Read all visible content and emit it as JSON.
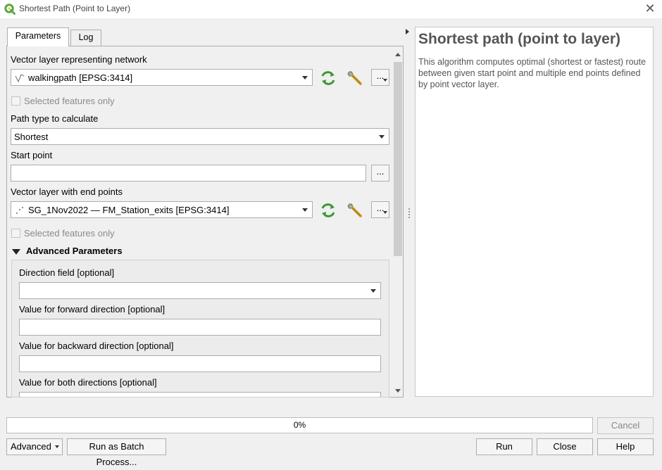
{
  "window": {
    "title": "Shortest Path (Point to Layer)",
    "accent_color": "#59a843"
  },
  "tabs": [
    {
      "label": "Parameters",
      "active": true
    },
    {
      "label": "Log",
      "active": false
    }
  ],
  "params": {
    "network_layer": {
      "label": "Vector layer representing network",
      "value": "walkingpath [EPSG:3414]",
      "selected_only_label": "Selected features only",
      "ellipsis": "..."
    },
    "path_type": {
      "label": "Path type to calculate",
      "value": "Shortest"
    },
    "start_point": {
      "label": "Start point",
      "value": "",
      "ellipsis": "..."
    },
    "end_points_layer": {
      "label": "Vector layer with end points",
      "value": "SG_1Nov2022 — FM_Station_exits [EPSG:3414]",
      "selected_only_label": "Selected features only",
      "ellipsis": "..."
    },
    "advanced": {
      "header": "Advanced Parameters",
      "direction_field_label": "Direction field [optional]",
      "direction_field_value": "",
      "forward_label": "Value for forward direction [optional]",
      "forward_value": "",
      "backward_label": "Value for backward direction [optional]",
      "backward_value": "",
      "both_label": "Value for both directions [optional]"
    }
  },
  "help": {
    "title": "Shortest path (point to layer)",
    "body": "This algorithm computes optimal (shortest or fastest) route between given start point and multiple end points defined by point vector layer."
  },
  "progress": {
    "value": 0,
    "text": "0%"
  },
  "buttons": {
    "cancel": "Cancel",
    "advanced": "Advanced",
    "batch": "Run as Batch Process...",
    "run": "Run",
    "close": "Close",
    "help": "Help"
  }
}
